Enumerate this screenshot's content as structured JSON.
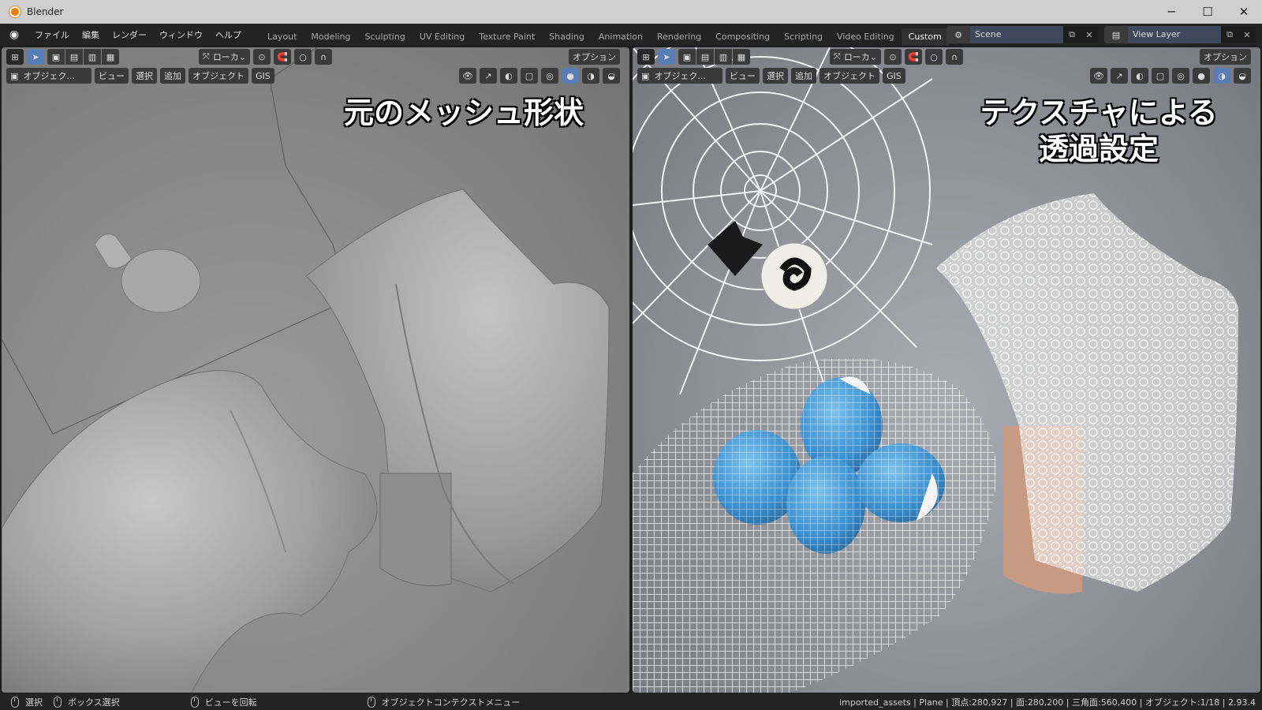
{
  "window": {
    "title": "Blender",
    "minimize": "─",
    "maximize": "☐",
    "close": "✕"
  },
  "menu": [
    "ファイル",
    "編集",
    "レンダー",
    "ウィンドウ",
    "ヘルプ"
  ],
  "workspaces": [
    "Layout",
    "Modeling",
    "Sculpting",
    "UV Editing",
    "Texture Paint",
    "Shading",
    "Animation",
    "Rendering",
    "Compositing",
    "Scripting",
    "Video Editing",
    "Custom"
  ],
  "active_workspace": "Custom",
  "scene": {
    "name": "Scene",
    "view_layer": "View Layer"
  },
  "viewport_left": {
    "mode": "オブジェク...",
    "menus": [
      "ビュー",
      "選択",
      "追加",
      "オブジェクト",
      "GIS"
    ],
    "transform_orientation": "ローカ",
    "options": "オプション",
    "overlay_text": "元のメッシュ形状"
  },
  "viewport_right": {
    "mode": "オブジェク...",
    "menus": [
      "ビュー",
      "選択",
      "追加",
      "オブジェクト",
      "GIS"
    ],
    "transform_orientation": "ローカ",
    "options": "オプション",
    "overlay_text_1": "テクスチャによる",
    "overlay_text_2": "透過設定"
  },
  "statusbar": {
    "select": "選択",
    "box_select": "ボックス選択",
    "rotate_view": "ビューを回転",
    "context_menu": "オブジェクトコンテクストメニュー",
    "stats": "imported_assets | Plane | 頂点:280,927 | 面:280,200 | 三角面:560,400 | オブジェクト:1/18 | 2.93.4"
  },
  "colors": {
    "accent": "#5a7db5",
    "titlebar": "#cfcfcf",
    "topbar": "#232323",
    "header": "#303030"
  }
}
